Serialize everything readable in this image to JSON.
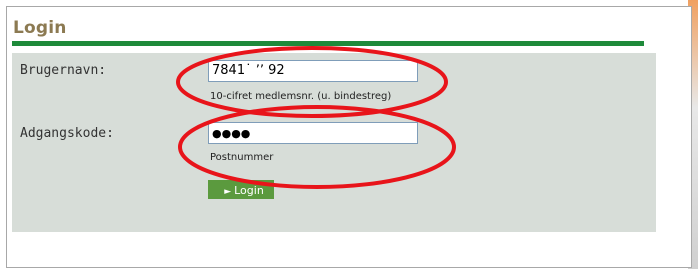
{
  "login": {
    "title": "Login",
    "username_label": "Brugernavn:",
    "username_value": "7841˙ ʼʼ   92",
    "username_hint": "10-cifret medlemsnr. (u. bindestreg)",
    "password_label": "Adgangskode:",
    "password_value": "●●●●",
    "password_hint": "Postnummer",
    "button_label": "Login"
  },
  "colors": {
    "title": "#8c7a52",
    "rule": "#1e8a3a",
    "form_bg": "#d7ddd8",
    "button": "#5b9a3e",
    "annotation": "#e8141a"
  },
  "icons": {
    "button_arrow": "chevron-right-icon"
  }
}
